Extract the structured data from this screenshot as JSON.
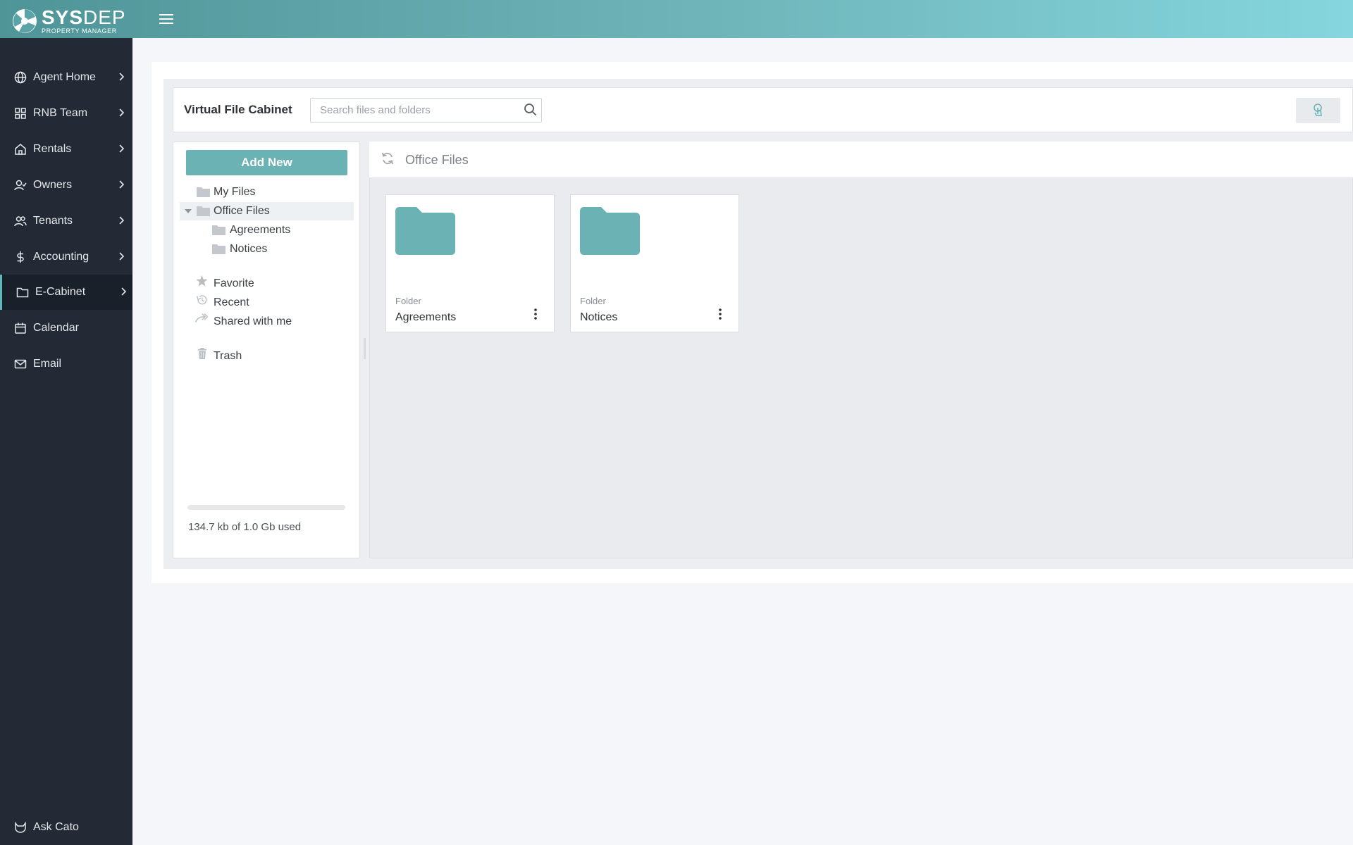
{
  "app": {
    "brand_bold": "SYS",
    "brand_light": "DEP",
    "brand_sub": "PROPERTY MANAGER"
  },
  "sidebar": {
    "items": [
      {
        "label": "Agent Home",
        "icon": "globe-icon"
      },
      {
        "label": "RNB Team",
        "icon": "grid-icon"
      },
      {
        "label": "Rentals",
        "icon": "home-icon"
      },
      {
        "label": "Owners",
        "icon": "user-check-icon"
      },
      {
        "label": "Tenants",
        "icon": "users-icon"
      },
      {
        "label": "Accounting",
        "icon": "dollar-icon"
      },
      {
        "label": "E-Cabinet",
        "icon": "folder-icon",
        "active": true
      },
      {
        "label": "Calendar",
        "icon": "calendar-icon"
      },
      {
        "label": "Email",
        "icon": "mail-icon"
      }
    ],
    "footer": {
      "label": "Ask Cato",
      "icon": "cat-icon"
    }
  },
  "cabinet": {
    "title": "Virtual File Cabinet",
    "search_placeholder": "Search files and folders",
    "add_new_label": "Add New",
    "tree": {
      "my_files": "My Files",
      "office_files": "Office Files",
      "agreements": "Agreements",
      "notices": "Notices",
      "favorite": "Favorite",
      "recent": "Recent",
      "shared": "Shared with me",
      "trash": "Trash"
    },
    "usage": {
      "text": "134.7 kb of 1.0 Gb used",
      "fraction": 0.0001
    }
  },
  "main": {
    "breadcrumb": "Office Files",
    "tiles": [
      {
        "type": "Folder",
        "name": "Agreements"
      },
      {
        "type": "Folder",
        "name": "Notices"
      }
    ]
  },
  "colors": {
    "accent": "#6bb2b5",
    "sidebar_bg": "#232a36",
    "folder": "#6bb2b5"
  }
}
